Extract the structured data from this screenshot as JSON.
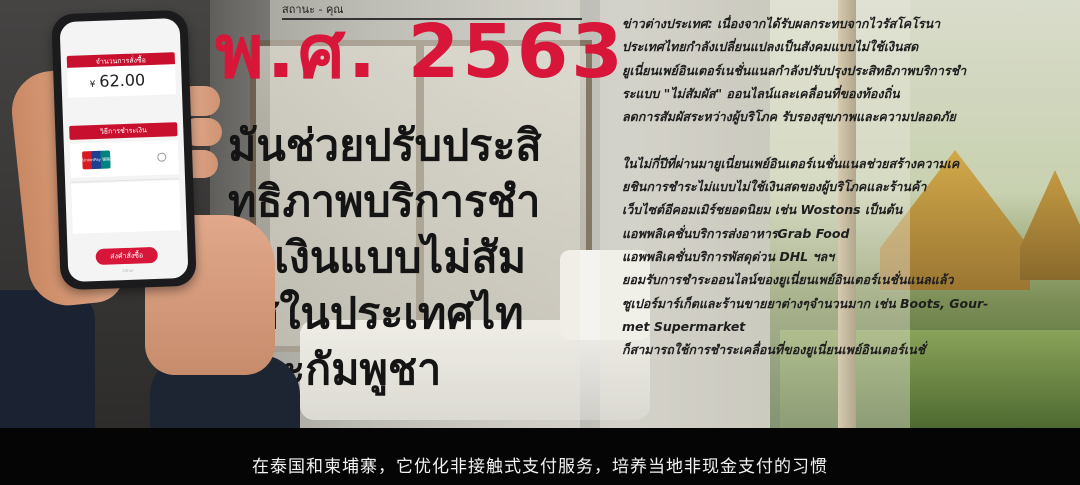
{
  "scene": {
    "year_text": "พ.ศ. 2563",
    "topbar_text": "สถานะ - คุณ",
    "heading_lines": [
      "มันช่วยปรับประสิ",
      "ทธิภาพบริการชำ",
      "ระเงินแบบไม่สัม",
      "ผัสในประเทศไท",
      "และกัมพูชา"
    ],
    "article_lines": [
      "ข่าวต่างประเทศ: เนื่องจากได้รับผลกระทบจากไวรัสโคโรนา",
      "ประเทศไทยกำลังเปลี่ยนแปลงเป็นสังคมแบบไม่ใช้เงินสด",
      "ยูเนี่ยนเพย์อินเตอร์เนชั่นแนลกำลังปรับปรุงประสิทธิภาพบริการชำ",
      "ระแบบ \"ไม่สัมผัส\" ออนไลน์และเคลื่อนที่ของท้องถิ่น",
      "ลดการสัมผัสระหว่างผู้บริโภค รับรองสุขภาพและความปลอดภัย",
      "",
      "ในไม่กี่ปีที่ผ่านมายูเนี่ยนเพย์อินเตอร์เนชั่นแนลช่วยสร้างความเค",
      "ยชินการชำระไม่แบบไม่ใช้เงินสดของผู้บริโภคและร้านค้า",
      "เว็บไซต์อีคอมเมิร์ชยอดนิยม เช่น Wostons เป็นต้น",
      "แอพพลิเคชั่นบริการส่งอาหารGrab Food",
      "แอพพลิเคชั่นบริการพัสดุด่วน DHL ฯลฯ",
      "ยอมรับการชำระออนไลน์ของยูเนี่ยนเพย์อินเตอร์เนชั่นแนลแล้ว",
      "ซูเปอร์มาร์เก็ตและร้านขายยาต่างๆจำนวนมาก เช่น Boots, Gour-",
      "met Supermarket",
      "ก็สามารถใช้การชำระเคลื่อนที่ของยูเนี่ยนเพย์อินเตอร์เนชั่"
    ]
  },
  "phone": {
    "amount_header": "จำนวนการสั่งซื้อ",
    "currency": "¥",
    "amount": "62.00",
    "payment_header": "วิธีการชำระเงิน",
    "card_logo": "UnionPay 银联",
    "submit_label": "ส่งคำสั่งซื้อ",
    "note": "Other"
  },
  "subtitle": "在泰国和柬埔寨，它优化非接触式支付服务，培养当地非现金支付的习惯",
  "colors": {
    "accent_red": "#d7163a",
    "subtitle_band": "#050505"
  }
}
